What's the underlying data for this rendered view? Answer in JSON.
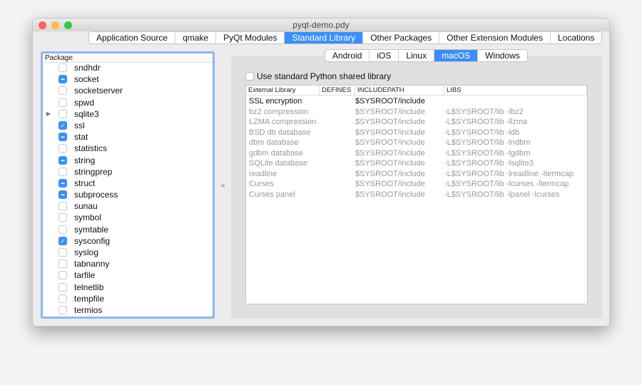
{
  "window": {
    "title": "pyqt-demo.pdy"
  },
  "main_tabs": [
    {
      "label": "Application Source"
    },
    {
      "label": "qmake"
    },
    {
      "label": "PyQt Modules"
    },
    {
      "label": "Standard Library",
      "active": true
    },
    {
      "label": "Other Packages"
    },
    {
      "label": "Other Extension Modules"
    },
    {
      "label": "Locations"
    }
  ],
  "packages": {
    "header": "Package",
    "items": [
      {
        "label": "sndhdr",
        "state": "unchecked"
      },
      {
        "label": "socket",
        "state": "partial"
      },
      {
        "label": "socketserver",
        "state": "unchecked"
      },
      {
        "label": "spwd",
        "state": "unchecked"
      },
      {
        "label": "sqlite3",
        "state": "unchecked",
        "expandable": true
      },
      {
        "label": "ssl",
        "state": "checked"
      },
      {
        "label": "stat",
        "state": "partial"
      },
      {
        "label": "statistics",
        "state": "unchecked"
      },
      {
        "label": "string",
        "state": "partial"
      },
      {
        "label": "stringprep",
        "state": "unchecked"
      },
      {
        "label": "struct",
        "state": "partial"
      },
      {
        "label": "subprocess",
        "state": "partial"
      },
      {
        "label": "sunau",
        "state": "unchecked"
      },
      {
        "label": "symbol",
        "state": "unchecked"
      },
      {
        "label": "symtable",
        "state": "unchecked"
      },
      {
        "label": "sysconfig",
        "state": "checked"
      },
      {
        "label": "syslog",
        "state": "unchecked"
      },
      {
        "label": "tabnanny",
        "state": "unchecked"
      },
      {
        "label": "tarfile",
        "state": "unchecked"
      },
      {
        "label": "telnetlib",
        "state": "unchecked"
      },
      {
        "label": "tempfile",
        "state": "unchecked"
      },
      {
        "label": "termios",
        "state": "unchecked"
      }
    ]
  },
  "platform_tabs": [
    {
      "label": "Android"
    },
    {
      "label": "iOS"
    },
    {
      "label": "Linux"
    },
    {
      "label": "macOS",
      "active": true
    },
    {
      "label": "Windows"
    }
  ],
  "use_shared": {
    "label": "Use standard Python shared library",
    "checked": false
  },
  "libs": {
    "columns": [
      "External Library",
      "DEFINES",
      "INCLUDEPATH",
      "LIBS"
    ],
    "rows": [
      [
        "SSL encryption",
        "",
        "$SYSROOT/include",
        ""
      ],
      [
        "bz2 compression",
        "",
        "$SYSROOT/include",
        "-L$SYSROOT/lib -lbz2"
      ],
      [
        "LZMA compression",
        "",
        "$SYSROOT/include",
        "-L$SYSROOT/lib -llzma"
      ],
      [
        "BSD db database",
        "",
        "$SYSROOT/include",
        "-L$SYSROOT/lib -ldb"
      ],
      [
        "dbm database",
        "",
        "$SYSROOT/include",
        "-L$SYSROOT/lib -lndbm"
      ],
      [
        "gdbm database",
        "",
        "$SYSROOT/include",
        "-L$SYSROOT/lib -lgdbm"
      ],
      [
        "SQLite database",
        "",
        "$SYSROOT/include",
        "-L$SYSROOT/lib -lsqlite3"
      ],
      [
        "readline",
        "",
        "$SYSROOT/include",
        "-L$SYSROOT/lib -lreadline -ltermcap"
      ],
      [
        "Curses",
        "",
        "$SYSROOT/include",
        "-L$SYSROOT/lib -lcurses -ltermcap"
      ],
      [
        "Curses panel",
        "",
        "$SYSROOT/include",
        "-L$SYSROOT/lib -lpanel -lcurses"
      ]
    ]
  },
  "colors": {
    "accent": "#3b8ff7",
    "close": "#fc605b",
    "minimize": "#fdbc40",
    "zoom": "#34c84a"
  }
}
